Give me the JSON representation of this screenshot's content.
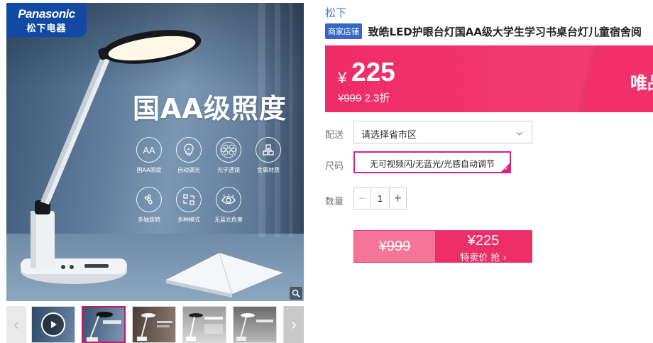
{
  "gallery": {
    "brand_en": "Panasonic",
    "brand_cn": "松下电器",
    "headline": "国AA级照度",
    "features": [
      {
        "icon": "aa-icon",
        "glyph": "AA",
        "label": "国AA照度"
      },
      {
        "icon": "ai-icon",
        "glyph": "AI",
        "label": "自动调光"
      },
      {
        "icon": "lens-icon",
        "glyph": "",
        "label": "光学透镜"
      },
      {
        "icon": "metal-icon",
        "glyph": "",
        "label": "金属材质"
      },
      {
        "icon": "rotate-icon",
        "glyph": "",
        "label": "多轴旋转"
      },
      {
        "icon": "modes-icon",
        "glyph": "",
        "label": "多种模式"
      },
      {
        "icon": "eye-icon",
        "glyph": "",
        "label": "无蓝光危害"
      }
    ],
    "thumbnail_count": 6,
    "active_thumbnail": 1
  },
  "product": {
    "brand_link": "松下",
    "store_tag": "商家店铺",
    "title": "致皓LED护眼台灯国AA级大学生学习书桌台灯儿童宿舍阅"
  },
  "price": {
    "currency": "¥",
    "current": "225",
    "original": "¥999",
    "discount": "2.3折",
    "promo_label": "唯品",
    "accent_color": "#ef2b67"
  },
  "delivery": {
    "label": "配送",
    "placeholder": "请选择省市区"
  },
  "spec": {
    "label": "尺码",
    "selected": "无可视频闪/无蓝光/光感自动调节"
  },
  "quantity": {
    "label": "数量",
    "value": "1"
  },
  "buy": {
    "original": "¥999",
    "price": "¥225",
    "action": "特卖价 抢 ›"
  }
}
